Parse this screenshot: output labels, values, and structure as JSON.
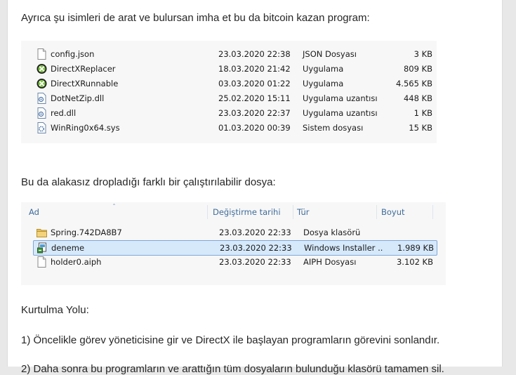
{
  "intro_text": "Ayrıca şu isimleri de arat ve bulursan imha et bu da bitcoin kazan program:",
  "table1": {
    "rows": [
      {
        "name": "config.json",
        "date": "23.03.2020 22:38",
        "type": "JSON Dosyası",
        "size": "3 KB",
        "icon": "file-icon"
      },
      {
        "name": "DirectXReplacer",
        "date": "18.03.2020 21:42",
        "type": "Uygulama",
        "size": "809 KB",
        "icon": "xbox-app-icon"
      },
      {
        "name": "DirectXRunnable",
        "date": "03.03.2020 01:22",
        "type": "Uygulama",
        "size": "4.565 KB",
        "icon": "xbox-app-icon"
      },
      {
        "name": "DotNetZip.dll",
        "date": "25.02.2020 15:11",
        "type": "Uygulama uzantısı",
        "size": "448 KB",
        "icon": "dll-file-icon"
      },
      {
        "name": "red.dll",
        "date": "23.03.2020 22:37",
        "type": "Uygulama uzantısı",
        "size": "1 KB",
        "icon": "dll-file-icon"
      },
      {
        "name": "WinRing0x64.sys",
        "date": "01.03.2020 00:39",
        "type": "Sistem dosyası",
        "size": "15 KB",
        "icon": "sys-file-icon"
      }
    ]
  },
  "second_text": "Bu da alakasız dropladığı farklı bir çalıştırılabilir dosya:",
  "table2": {
    "headers": {
      "name": "Ad",
      "date": "Değiştirme tarihi",
      "type": "Tür",
      "size": "Boyut"
    },
    "rows": [
      {
        "name": "Spring.742DA8B7",
        "date": "23.03.2020 22:33",
        "type": "Dosya klasörü",
        "size": "",
        "icon": "folder-icon",
        "selected": false
      },
      {
        "name": "deneme",
        "date": "23.03.2020 22:33",
        "type": "Windows Installer ...",
        "size": "1.989 KB",
        "icon": "installer-icon",
        "selected": true
      },
      {
        "name": "holder0.aiph",
        "date": "23.03.2020 22:33",
        "type": "AIPH Dosyası",
        "size": "3.102 KB",
        "icon": "file-icon",
        "selected": false
      }
    ]
  },
  "section_title": "Kurtulma Yolu:",
  "step1": "1) Öncelikle görev yöneticisine gir ve DirectX ile başlayan programların görevini sonlandır.",
  "step2_partial": "2) Daha sonra bu programların ve arattığın tüm dosyaların bulunduğu klasörü tamamen sil."
}
